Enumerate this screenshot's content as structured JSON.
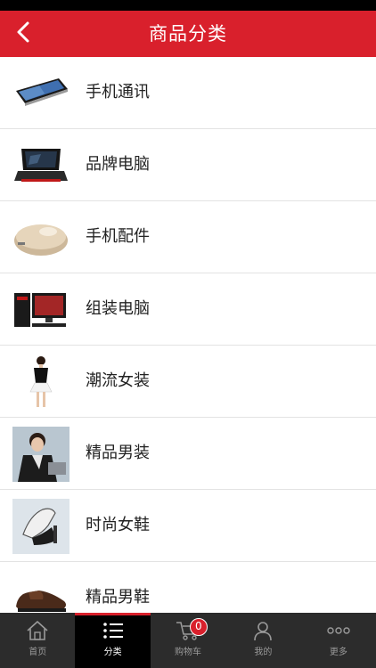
{
  "header": {
    "title": "商品分类",
    "back_icon": "chevron-left-icon"
  },
  "categories": [
    {
      "label": "手机通讯",
      "thumb": "smartphone"
    },
    {
      "label": "品牌电脑",
      "thumb": "laptop"
    },
    {
      "label": "手机配件",
      "thumb": "power-bank"
    },
    {
      "label": "组装电脑",
      "thumb": "desktop-pc"
    },
    {
      "label": "潮流女装",
      "thumb": "womens-fashion"
    },
    {
      "label": "精品男装",
      "thumb": "mens-fashion"
    },
    {
      "label": "时尚女鞋",
      "thumb": "womens-shoes"
    },
    {
      "label": "精品男鞋",
      "thumb": "mens-shoes"
    }
  ],
  "tabbar": {
    "tabs": [
      {
        "label": "首页",
        "icon": "home-icon"
      },
      {
        "label": "分类",
        "icon": "list-icon",
        "active": true
      },
      {
        "label": "购物车",
        "icon": "cart-icon",
        "badge": "0"
      },
      {
        "label": "我的",
        "icon": "user-icon"
      },
      {
        "label": "更多",
        "icon": "more-icon"
      }
    ]
  },
  "colors": {
    "brand_red": "#d9202c",
    "tabbar_bg": "#2c2c2c",
    "active_tab_bg": "#000000"
  }
}
